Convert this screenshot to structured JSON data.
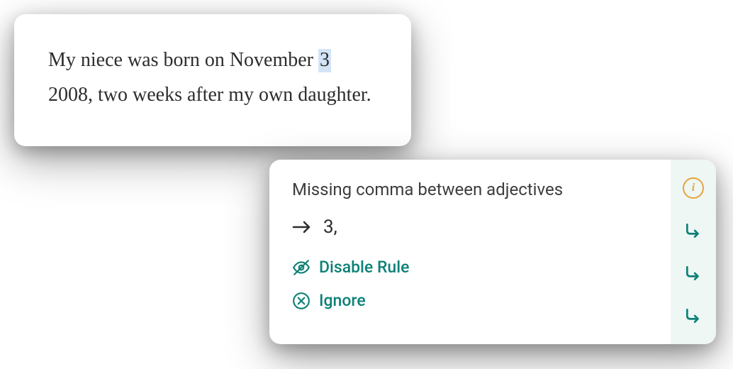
{
  "text_card": {
    "before": "My niece was born on November ",
    "highlighted": "3",
    "after": " 2008, two weeks after my own daughter."
  },
  "suggestion": {
    "rule_title": "Missing comma between adjectives",
    "correction": "3,",
    "actions": {
      "disable_label": "Disable Rule",
      "ignore_label": "Ignore"
    }
  }
}
